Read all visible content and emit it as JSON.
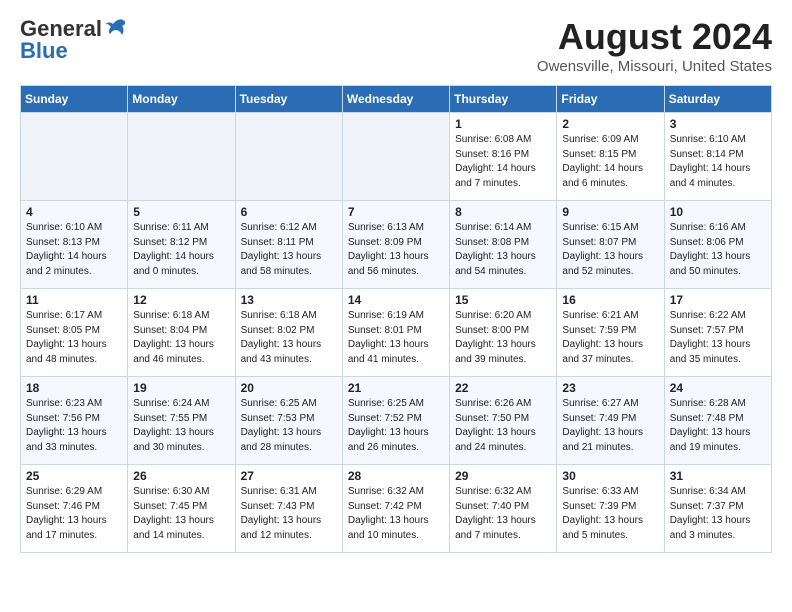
{
  "header": {
    "logo_general": "General",
    "logo_blue": "Blue",
    "month_title": "August 2024",
    "location": "Owensville, Missouri, United States"
  },
  "days_of_week": [
    "Sunday",
    "Monday",
    "Tuesday",
    "Wednesday",
    "Thursday",
    "Friday",
    "Saturday"
  ],
  "weeks": [
    [
      {
        "day": "",
        "info": ""
      },
      {
        "day": "",
        "info": ""
      },
      {
        "day": "",
        "info": ""
      },
      {
        "day": "",
        "info": ""
      },
      {
        "day": "1",
        "info": "Sunrise: 6:08 AM\nSunset: 8:16 PM\nDaylight: 14 hours\nand 7 minutes."
      },
      {
        "day": "2",
        "info": "Sunrise: 6:09 AM\nSunset: 8:15 PM\nDaylight: 14 hours\nand 6 minutes."
      },
      {
        "day": "3",
        "info": "Sunrise: 6:10 AM\nSunset: 8:14 PM\nDaylight: 14 hours\nand 4 minutes."
      }
    ],
    [
      {
        "day": "4",
        "info": "Sunrise: 6:10 AM\nSunset: 8:13 PM\nDaylight: 14 hours\nand 2 minutes."
      },
      {
        "day": "5",
        "info": "Sunrise: 6:11 AM\nSunset: 8:12 PM\nDaylight: 14 hours\nand 0 minutes."
      },
      {
        "day": "6",
        "info": "Sunrise: 6:12 AM\nSunset: 8:11 PM\nDaylight: 13 hours\nand 58 minutes."
      },
      {
        "day": "7",
        "info": "Sunrise: 6:13 AM\nSunset: 8:09 PM\nDaylight: 13 hours\nand 56 minutes."
      },
      {
        "day": "8",
        "info": "Sunrise: 6:14 AM\nSunset: 8:08 PM\nDaylight: 13 hours\nand 54 minutes."
      },
      {
        "day": "9",
        "info": "Sunrise: 6:15 AM\nSunset: 8:07 PM\nDaylight: 13 hours\nand 52 minutes."
      },
      {
        "day": "10",
        "info": "Sunrise: 6:16 AM\nSunset: 8:06 PM\nDaylight: 13 hours\nand 50 minutes."
      }
    ],
    [
      {
        "day": "11",
        "info": "Sunrise: 6:17 AM\nSunset: 8:05 PM\nDaylight: 13 hours\nand 48 minutes."
      },
      {
        "day": "12",
        "info": "Sunrise: 6:18 AM\nSunset: 8:04 PM\nDaylight: 13 hours\nand 46 minutes."
      },
      {
        "day": "13",
        "info": "Sunrise: 6:18 AM\nSunset: 8:02 PM\nDaylight: 13 hours\nand 43 minutes."
      },
      {
        "day": "14",
        "info": "Sunrise: 6:19 AM\nSunset: 8:01 PM\nDaylight: 13 hours\nand 41 minutes."
      },
      {
        "day": "15",
        "info": "Sunrise: 6:20 AM\nSunset: 8:00 PM\nDaylight: 13 hours\nand 39 minutes."
      },
      {
        "day": "16",
        "info": "Sunrise: 6:21 AM\nSunset: 7:59 PM\nDaylight: 13 hours\nand 37 minutes."
      },
      {
        "day": "17",
        "info": "Sunrise: 6:22 AM\nSunset: 7:57 PM\nDaylight: 13 hours\nand 35 minutes."
      }
    ],
    [
      {
        "day": "18",
        "info": "Sunrise: 6:23 AM\nSunset: 7:56 PM\nDaylight: 13 hours\nand 33 minutes."
      },
      {
        "day": "19",
        "info": "Sunrise: 6:24 AM\nSunset: 7:55 PM\nDaylight: 13 hours\nand 30 minutes."
      },
      {
        "day": "20",
        "info": "Sunrise: 6:25 AM\nSunset: 7:53 PM\nDaylight: 13 hours\nand 28 minutes."
      },
      {
        "day": "21",
        "info": "Sunrise: 6:25 AM\nSunset: 7:52 PM\nDaylight: 13 hours\nand 26 minutes."
      },
      {
        "day": "22",
        "info": "Sunrise: 6:26 AM\nSunset: 7:50 PM\nDaylight: 13 hours\nand 24 minutes."
      },
      {
        "day": "23",
        "info": "Sunrise: 6:27 AM\nSunset: 7:49 PM\nDaylight: 13 hours\nand 21 minutes."
      },
      {
        "day": "24",
        "info": "Sunrise: 6:28 AM\nSunset: 7:48 PM\nDaylight: 13 hours\nand 19 minutes."
      }
    ],
    [
      {
        "day": "25",
        "info": "Sunrise: 6:29 AM\nSunset: 7:46 PM\nDaylight: 13 hours\nand 17 minutes."
      },
      {
        "day": "26",
        "info": "Sunrise: 6:30 AM\nSunset: 7:45 PM\nDaylight: 13 hours\nand 14 minutes."
      },
      {
        "day": "27",
        "info": "Sunrise: 6:31 AM\nSunset: 7:43 PM\nDaylight: 13 hours\nand 12 minutes."
      },
      {
        "day": "28",
        "info": "Sunrise: 6:32 AM\nSunset: 7:42 PM\nDaylight: 13 hours\nand 10 minutes."
      },
      {
        "day": "29",
        "info": "Sunrise: 6:32 AM\nSunset: 7:40 PM\nDaylight: 13 hours\nand 7 minutes."
      },
      {
        "day": "30",
        "info": "Sunrise: 6:33 AM\nSunset: 7:39 PM\nDaylight: 13 hours\nand 5 minutes."
      },
      {
        "day": "31",
        "info": "Sunrise: 6:34 AM\nSunset: 7:37 PM\nDaylight: 13 hours\nand 3 minutes."
      }
    ]
  ]
}
